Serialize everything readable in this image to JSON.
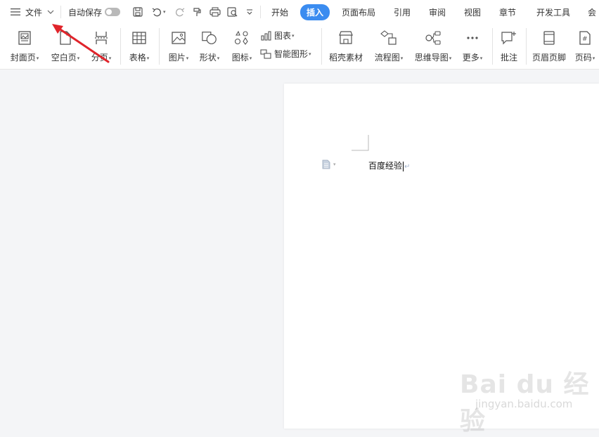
{
  "topbar": {
    "file_label": "文件",
    "autosave_label": "自动保存",
    "tabs": [
      {
        "label": "开始"
      },
      {
        "label": "插入"
      },
      {
        "label": "页面布局"
      },
      {
        "label": "引用"
      },
      {
        "label": "审阅"
      },
      {
        "label": "视图"
      },
      {
        "label": "章节"
      },
      {
        "label": "开发工具"
      },
      {
        "label": "会"
      }
    ],
    "active_tab": "插入",
    "accent_color": "#3b8cf0"
  },
  "ribbon": {
    "cover_page": "封面页",
    "blank_page": "空白页",
    "page_break": "分页",
    "table": "表格",
    "picture": "图片",
    "shape": "形状",
    "icon": "图标",
    "chart": "图表",
    "smart_art": "智能图形",
    "daoke_material": "稻壳素材",
    "flowchart": "流程图",
    "mindmap": "思维导图",
    "more": "更多",
    "comment": "批注",
    "header_footer": "页眉页脚",
    "page_number": "页码"
  },
  "document": {
    "text": "百度经验"
  },
  "watermark": {
    "brand": "Bai du 经验",
    "url": "jingyan.baidu.com"
  },
  "annotation": {
    "arrow_color": "#e0242b"
  }
}
